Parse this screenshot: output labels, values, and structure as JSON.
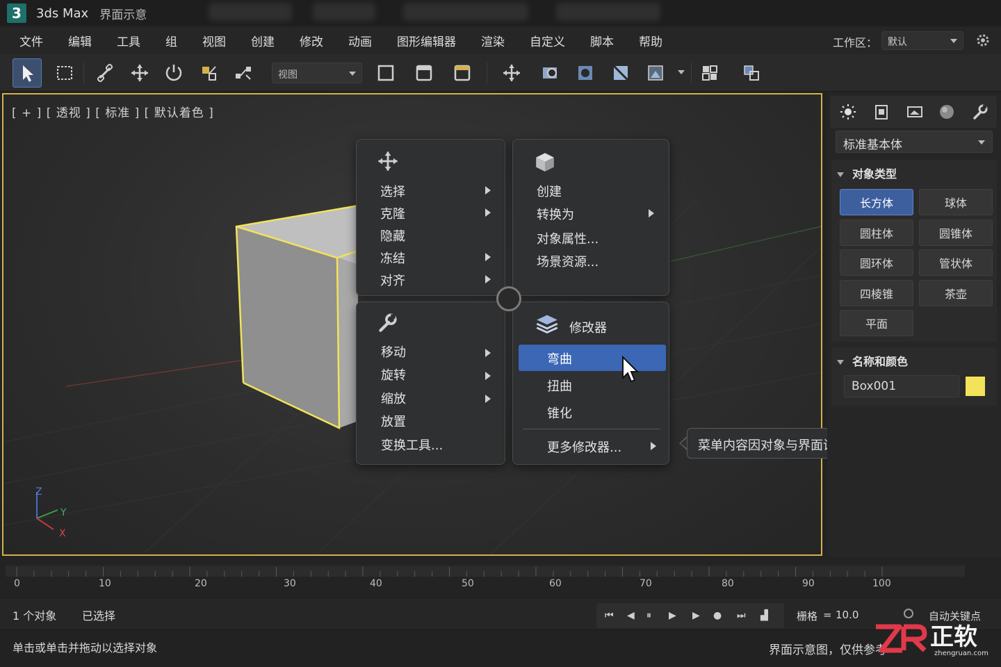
{
  "titlebar": {
    "logo": "3",
    "app_name": "3ds Max",
    "title_suffix": "界面示意"
  },
  "menubar": {
    "items": [
      "文件",
      "编辑",
      "工具",
      "组",
      "视图",
      "创建",
      "修改",
      "动画",
      "图形编辑器",
      "渲染",
      "自定义",
      "脚本",
      "帮助"
    ],
    "workspace_label": "工作区：",
    "workspace_value": "默认"
  },
  "toolbar": {
    "view_dropdown": "视图",
    "icons": [
      "select-arrow-icon",
      "select-region-icon",
      "link-icon",
      "move-icon",
      "rotate-icon",
      "scale-icon",
      "bind-icon",
      "render-frame-icon",
      "render-setup-icon",
      "render-icon",
      "pan-icon",
      "zoom-icon",
      "orbit-icon",
      "material-editor-icon",
      "render-production-icon",
      "layer-icon",
      "scene-explorer-icon"
    ]
  },
  "viewport": {
    "label": "[ + ] [ 透视 ] [ 标准 ] [ 默认着色 ]",
    "axis_z": "Z",
    "axis_y": "Y",
    "axis_x": "X"
  },
  "quad_menu": {
    "top_left": {
      "icon": "move-icon",
      "items": [
        {
          "label": "选择",
          "submenu": true
        },
        {
          "label": "克隆",
          "submenu": true
        },
        {
          "label": "隐藏",
          "submenu": false
        },
        {
          "label": "冻结",
          "submenu": true
        },
        {
          "label": "对齐",
          "submenu": true
        }
      ]
    },
    "top_right": {
      "icon": "cube-icon",
      "items": [
        {
          "label": "创建",
          "submenu": false
        },
        {
          "label": "转换为",
          "submenu": true
        },
        {
          "label": "对象属性...",
          "submenu": false
        },
        {
          "label": "场景资源...",
          "submenu": false
        }
      ]
    },
    "bottom_left": {
      "icon": "wrench-icon",
      "items": [
        {
          "label": "移动",
          "submenu": true
        },
        {
          "label": "旋转",
          "submenu": true
        },
        {
          "label": "缩放",
          "submenu": true
        },
        {
          "label": "放置",
          "submenu": false
        },
        {
          "label": "变换工具...",
          "submenu": false
        }
      ]
    },
    "bottom_right": {
      "icon": "layers-icon",
      "title": "修改器",
      "items": [
        {
          "label": "弯曲",
          "submenu": false,
          "highlighted": true
        },
        {
          "label": "扭曲",
          "submenu": false
        },
        {
          "label": "锥化",
          "submenu": false
        },
        {
          "label": "更多修改器...",
          "submenu": true
        }
      ]
    }
  },
  "tooltip": {
    "text": "菜单内容因对象与界面设置而异"
  },
  "command_panel": {
    "tabs": [
      "sun-icon",
      "clipboard-icon",
      "display-icon",
      "sphere-icon",
      "wrench-icon"
    ],
    "primitive_select": "标准基本体",
    "object_type_title": "对象类型",
    "object_buttons": [
      "长方体",
      "球体",
      "圆柱体",
      "圆锥体",
      "圆环体",
      "管状体",
      "四棱锥",
      "茶壶",
      "平面"
    ],
    "active_button": "长方体",
    "name_color_title": "名称和颜色",
    "object_name": "Box001",
    "object_color": "#f2e35a"
  },
  "timeline": {
    "ticks": [
      "0",
      "10",
      "20",
      "30",
      "40",
      "50",
      "60",
      "70",
      "80",
      "90",
      "100"
    ]
  },
  "status": {
    "object_count": "1 个对象",
    "selected": "已选择",
    "grid_label": "栅格",
    "grid_eq": "=",
    "grid_value": "10.0",
    "auto_key": "自动关键点",
    "prompt": "单击或单击并拖动以选择对象",
    "disclaimer": "界面示意图，仅供参考"
  },
  "watermark": {
    "brand": "正软",
    "site": "zhengruan.com"
  },
  "colors": {
    "accent": "#3b67b5",
    "viewport_border": "#d4b24a",
    "selection_yellow": "#f2e35a"
  }
}
